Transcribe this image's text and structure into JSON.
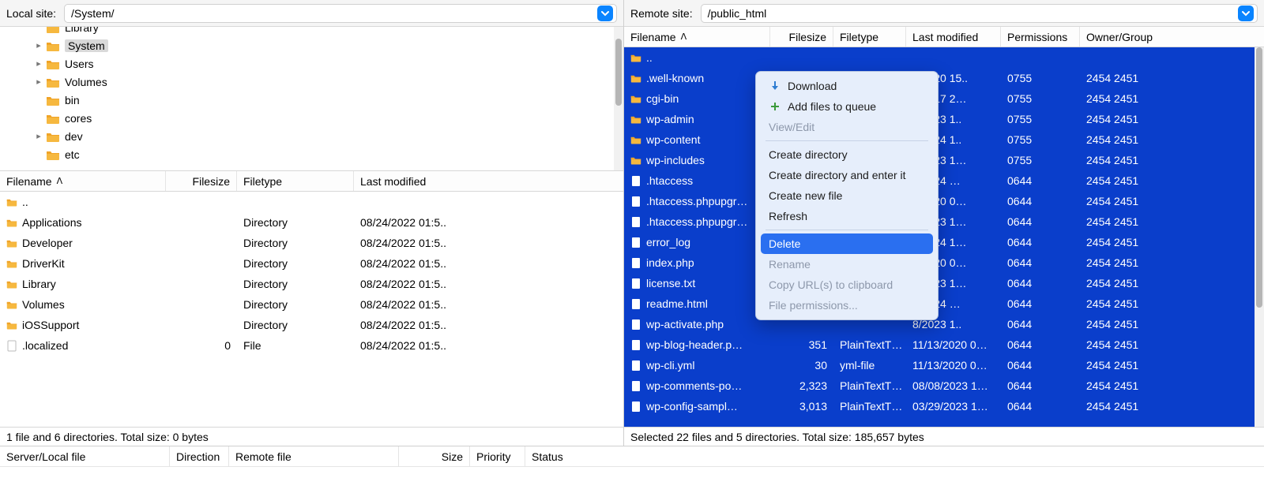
{
  "local": {
    "label": "Local site:",
    "path": "/System/",
    "tree": [
      {
        "indent": 34,
        "name": "Library",
        "twisty": "",
        "selected": false,
        "cut": true
      },
      {
        "indent": 34,
        "name": "System",
        "twisty": "▸",
        "selected": true
      },
      {
        "indent": 34,
        "name": "Users",
        "twisty": "▸",
        "selected": false
      },
      {
        "indent": 34,
        "name": "Volumes",
        "twisty": "▸",
        "selected": false
      },
      {
        "indent": 34,
        "name": "bin",
        "twisty": "",
        "selected": false
      },
      {
        "indent": 34,
        "name": "cores",
        "twisty": "",
        "selected": false
      },
      {
        "indent": 34,
        "name": "dev",
        "twisty": "▸",
        "selected": false
      },
      {
        "indent": 34,
        "name": "etc",
        "twisty": "",
        "selected": false
      }
    ],
    "cols": {
      "filename": "Filename",
      "filesize": "Filesize",
      "filetype": "Filetype",
      "lastmod": "Last modified"
    },
    "sort_arrow": "ᐱ",
    "rows": [
      {
        "icon": "folder",
        "name": "..",
        "size": "",
        "type": "",
        "mod": ""
      },
      {
        "icon": "folder",
        "name": "Applications",
        "size": "",
        "type": "Directory",
        "mod": "08/24/2022 01:5.."
      },
      {
        "icon": "folder",
        "name": "Developer",
        "size": "",
        "type": "Directory",
        "mod": "08/24/2022 01:5.."
      },
      {
        "icon": "folder",
        "name": "DriverKit",
        "size": "",
        "type": "Directory",
        "mod": "08/24/2022 01:5.."
      },
      {
        "icon": "folder",
        "name": "Library",
        "size": "",
        "type": "Directory",
        "mod": "08/24/2022 01:5.."
      },
      {
        "icon": "folder",
        "name": "Volumes",
        "size": "",
        "type": "Directory",
        "mod": "08/24/2022 01:5.."
      },
      {
        "icon": "folder",
        "name": "iOSSupport",
        "size": "",
        "type": "Directory",
        "mod": "08/24/2022 01:5.."
      },
      {
        "icon": "file-blank",
        "name": ".localized",
        "size": "0",
        "type": "File",
        "mod": "08/24/2022 01:5.."
      }
    ],
    "status": "1 file and 6 directories. Total size: 0 bytes"
  },
  "remote": {
    "label": "Remote site:",
    "path": "/public_html",
    "cols": {
      "filename": "Filename",
      "filesize": "Filesize",
      "filetype": "Filetype",
      "lastmod": "Last modified",
      "perms": "Permissions",
      "owner": "Owner/Group"
    },
    "sort_arrow": "ᐱ",
    "rows": [
      {
        "icon": "folder",
        "name": "..",
        "size": "",
        "type": "",
        "mod": "",
        "perm": "",
        "owner": ""
      },
      {
        "icon": "folder",
        "name": ".well-known",
        "size": "",
        "type": "",
        "mod": "2/2020 15..",
        "perm": "0755",
        "owner": "2454 2451"
      },
      {
        "icon": "folder",
        "name": "cgi-bin",
        "size": "",
        "type": "",
        "mod": "2/2017 2…",
        "perm": "0755",
        "owner": "2454 2451"
      },
      {
        "icon": "folder",
        "name": "wp-admin",
        "size": "",
        "type": "",
        "mod": "8/2023 1..",
        "perm": "0755",
        "owner": "2454 2451"
      },
      {
        "icon": "folder",
        "name": "wp-content",
        "size": "",
        "type": "",
        "mod": "8/2024 1..",
        "perm": "0755",
        "owner": "2454 2451"
      },
      {
        "icon": "folder",
        "name": "wp-includes",
        "size": "",
        "type": "",
        "mod": "7/2023 1…",
        "perm": "0755",
        "owner": "2454 2451"
      },
      {
        "icon": "file",
        "name": ".htaccess",
        "size": "",
        "type": "",
        "mod": "8/2024 …",
        "perm": "0644",
        "owner": "2454 2451"
      },
      {
        "icon": "file",
        "name": ".htaccess.phpupgr…",
        "size": "",
        "type": "",
        "mod": "7/2020 0…",
        "perm": "0644",
        "owner": "2454 2451"
      },
      {
        "icon": "file",
        "name": ".htaccess.phpupgr…",
        "size": "",
        "type": "",
        "mod": "7/2023 1…",
        "perm": "0644",
        "owner": "2454 2451"
      },
      {
        "icon": "file",
        "name": "error_log",
        "size": "",
        "type": "",
        "mod": "7/2024 1…",
        "perm": "0644",
        "owner": "2454 2451"
      },
      {
        "icon": "file",
        "name": "index.php",
        "size": "",
        "type": "",
        "mod": "7/2020 0…",
        "perm": "0644",
        "owner": "2454 2451"
      },
      {
        "icon": "file",
        "name": "license.txt",
        "size": "",
        "type": "",
        "mod": "7/2023 1…",
        "perm": "0644",
        "owner": "2454 2451"
      },
      {
        "icon": "file",
        "name": "readme.html",
        "size": "",
        "type": "",
        "mod": "0/2024 …",
        "perm": "0644",
        "owner": "2454 2451"
      },
      {
        "icon": "file",
        "name": "wp-activate.php",
        "size": "",
        "type": "",
        "mod": "8/2023 1..",
        "perm": "0644",
        "owner": "2454 2451"
      },
      {
        "icon": "file",
        "name": "wp-blog-header.p…",
        "size": "351",
        "type": "PlainTextT…",
        "mod": "11/13/2020 0…",
        "perm": "0644",
        "owner": "2454 2451"
      },
      {
        "icon": "file",
        "name": "wp-cli.yml",
        "size": "30",
        "type": "yml-file",
        "mod": "11/13/2020 0…",
        "perm": "0644",
        "owner": "2454 2451"
      },
      {
        "icon": "file",
        "name": "wp-comments-po…",
        "size": "2,323",
        "type": "PlainTextT…",
        "mod": "08/08/2023 1…",
        "perm": "0644",
        "owner": "2454 2451"
      },
      {
        "icon": "file",
        "name": "wp-config-sampl…",
        "size": "3,013",
        "type": "PlainTextT…",
        "mod": "03/29/2023 1…",
        "perm": "0644",
        "owner": "2454 2451"
      }
    ],
    "status": "Selected 22 files and 5 directories. Total size: 185,657 bytes"
  },
  "context_menu": {
    "items": [
      {
        "label": "Download",
        "icon": "download",
        "disabled": false
      },
      {
        "label": "Add files to queue",
        "icon": "add",
        "disabled": false
      },
      {
        "label": "View/Edit",
        "disabled": true
      },
      {
        "sep": true
      },
      {
        "label": "Create directory",
        "disabled": false
      },
      {
        "label": "Create directory and enter it",
        "disabled": false
      },
      {
        "label": "Create new file",
        "disabled": false
      },
      {
        "label": "Refresh",
        "disabled": false
      },
      {
        "sep": true
      },
      {
        "label": "Delete",
        "highlight": true
      },
      {
        "label": "Rename",
        "disabled": true
      },
      {
        "label": "Copy URL(s) to clipboard",
        "disabled": true
      },
      {
        "label": "File permissions...",
        "disabled": true
      }
    ]
  },
  "queue_cols": {
    "serverfile": "Server/Local file",
    "direction": "Direction",
    "remotefile": "Remote file",
    "size": "Size",
    "priority": "Priority",
    "status": "Status"
  }
}
